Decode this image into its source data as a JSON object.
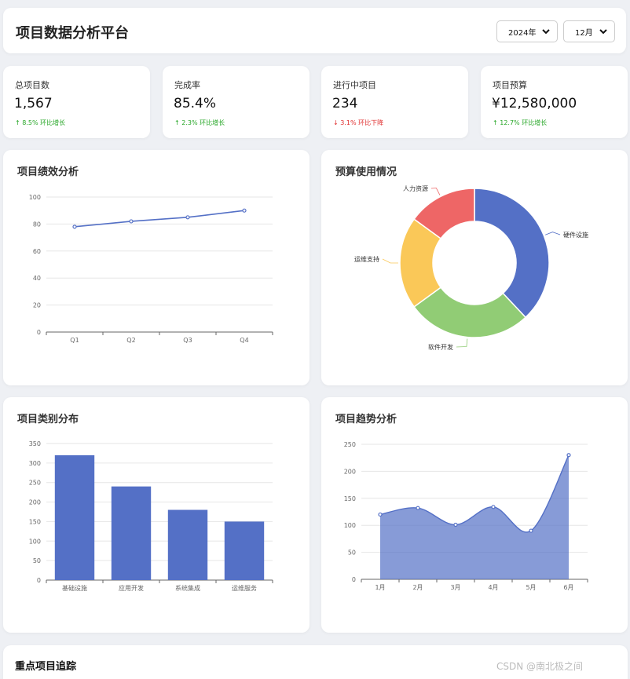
{
  "header": {
    "title": "项目数据分析平台",
    "year_select": "2024年",
    "month_select": "12月"
  },
  "stats": [
    {
      "label": "总项目数",
      "value": "1,567",
      "trend": "↑ 8.5% 环比增长",
      "direction": "up"
    },
    {
      "label": "完成率",
      "value": "85.4%",
      "trend": "↑ 2.3% 环比增长",
      "direction": "up"
    },
    {
      "label": "进行中项目",
      "value": "234",
      "trend": "↓ 3.1% 环比下降",
      "direction": "down"
    },
    {
      "label": "项目预算",
      "value": "¥12,580,000",
      "trend": "↑ 12.7% 环比增长",
      "direction": "up"
    }
  ],
  "panels": {
    "perf_title": "项目绩效分析",
    "budget_title": "预算使用情况",
    "category_title": "项目类别分布",
    "trend_title": "项目趋势分析",
    "key_title": "重点项目追踪"
  },
  "colors": {
    "blue": "#5470c6",
    "green": "#91cc75",
    "yellow": "#fac858",
    "red": "#ee6666",
    "up": "#26a626",
    "down": "#e03030"
  },
  "chart_data": [
    {
      "type": "line",
      "categories": [
        "Q1",
        "Q2",
        "Q3",
        "Q4"
      ],
      "values": [
        78,
        82,
        85,
        90
      ],
      "ylim": [
        0,
        100
      ],
      "yticks": [
        0,
        20,
        40,
        60,
        80,
        100
      ],
      "grid": true
    },
    {
      "type": "pie",
      "donut": true,
      "slices": [
        {
          "name": "硬件设施",
          "value": 38
        },
        {
          "name": "软件开发",
          "value": 27
        },
        {
          "name": "运维支持",
          "value": 20
        },
        {
          "name": "人力资源",
          "value": 15
        }
      ]
    },
    {
      "type": "bar",
      "categories": [
        "基础设施",
        "应用开发",
        "系统集成",
        "运维服务"
      ],
      "values": [
        320,
        240,
        180,
        150
      ],
      "ylim": [
        0,
        350
      ],
      "yticks": [
        0,
        50,
        100,
        150,
        200,
        250,
        300,
        350
      ],
      "grid": true
    },
    {
      "type": "area",
      "categories": [
        "1月",
        "2月",
        "3月",
        "4月",
        "5月",
        "6月"
      ],
      "values": [
        120,
        132,
        101,
        134,
        90,
        230
      ],
      "ylim": [
        0,
        250
      ],
      "yticks": [
        0,
        50,
        100,
        150,
        200,
        250
      ],
      "smooth": true,
      "grid": true
    }
  ],
  "watermark": "CSDN @南北极之间"
}
